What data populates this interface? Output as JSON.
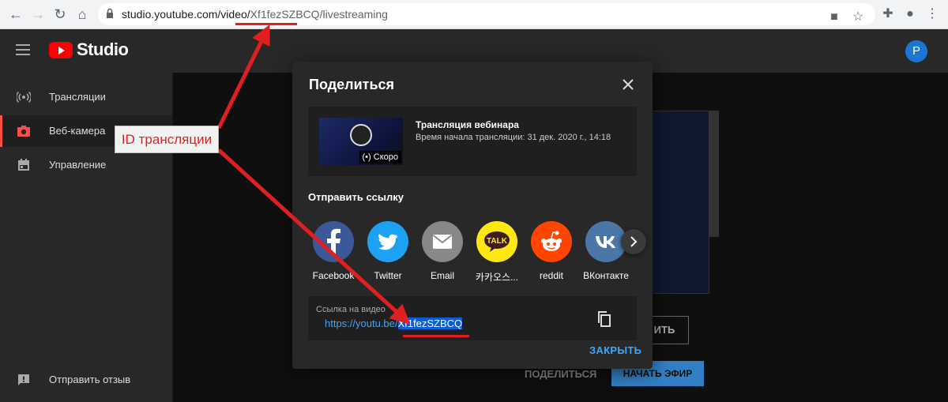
{
  "browser": {
    "url_host": "studio.youtube.com/video/",
    "url_id": "Xf1fezSZBCQ",
    "url_rest": "/livestreaming"
  },
  "header": {
    "logo_text": "Studio",
    "avatar_letter": "P"
  },
  "sidebar": {
    "items": [
      {
        "label": "Трансляции",
        "icon": "broadcast-icon"
      },
      {
        "label": "Веб-камера",
        "icon": "camera-icon"
      },
      {
        "label": "Управление",
        "icon": "calendar-icon"
      }
    ],
    "feedback_label": "Отправить отзыв"
  },
  "main": {
    "share_label": "ПОДЕЛИТЬСЯ",
    "go_live_label": "НАЧАТЬ ЭФИР",
    "ghost_label": "ИТЬ"
  },
  "dialog": {
    "title": "Поделиться",
    "video_title": "Трансляция вебинара",
    "video_time": "Время начала трансляции: 31 дек. 2020 г., 14:18",
    "badge": "Скоро",
    "send_label": "Отправить ссылку",
    "share_targets": [
      {
        "label": "Facebook",
        "color": "#3b5998",
        "icon": "facebook-icon"
      },
      {
        "label": "Twitter",
        "color": "#1da1f2",
        "icon": "twitter-icon"
      },
      {
        "label": "Email",
        "color": "#888888",
        "icon": "email-icon"
      },
      {
        "label": "카카오스...",
        "color": "#ffe812",
        "icon": "kakao-talk-icon"
      },
      {
        "label": "reddit",
        "color": "#ff4500",
        "icon": "reddit-icon"
      },
      {
        "label": "ВКонтакте",
        "color": "#4a76a8",
        "icon": "vk-icon"
      }
    ],
    "kakao_badge": "TALK",
    "link_label": "Ссылка на видео",
    "link_prefix": "https://youtu.be/",
    "link_id": "Xf1fezSZBCQ",
    "close_label": "ЗАКРЫТЬ"
  },
  "annotation": {
    "label": "ID трансляции",
    "color": "#e02020"
  }
}
